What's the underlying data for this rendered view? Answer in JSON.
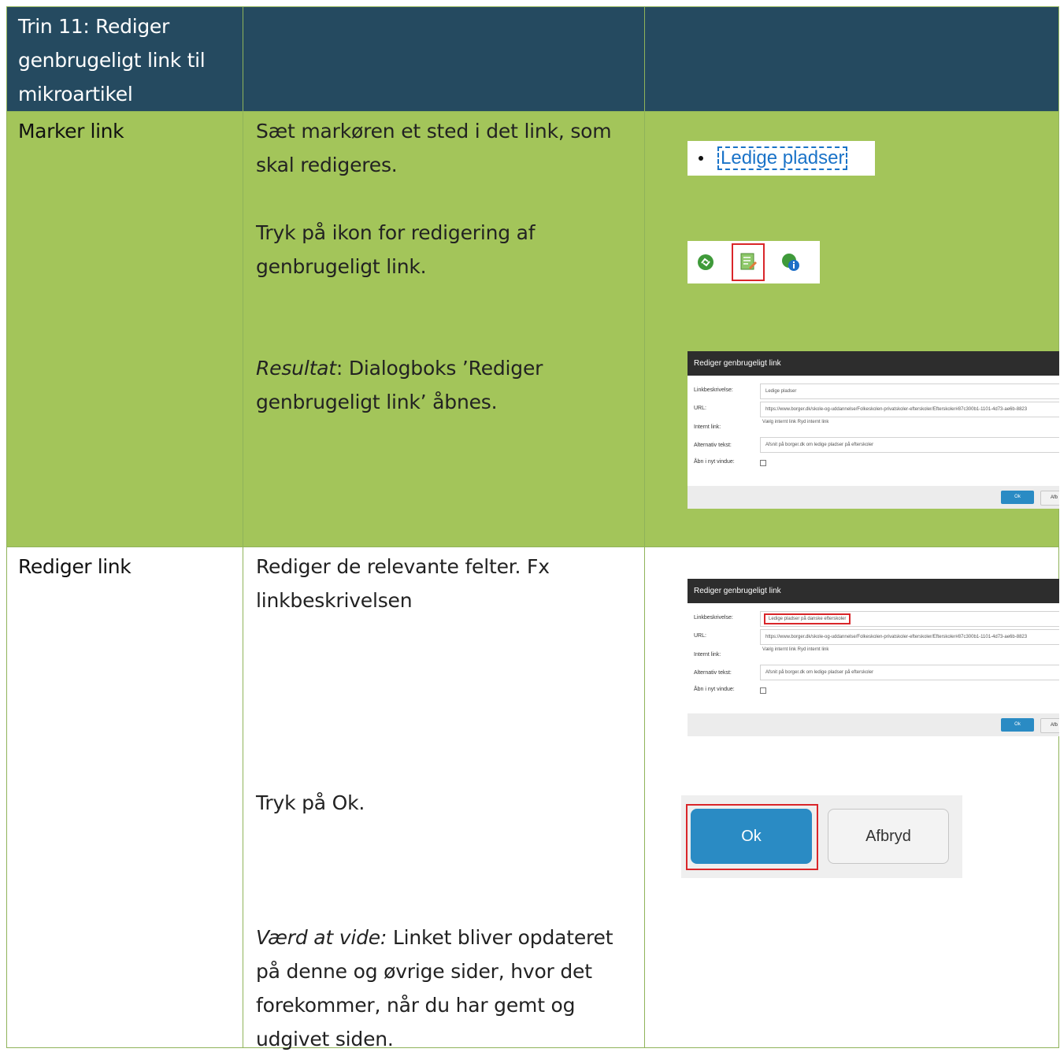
{
  "header": {
    "title": "Trin 11: Rediger genbrugeligt link til mikroartikel"
  },
  "row1": {
    "label": "Marker link",
    "instruction1": "Sæt markøren et sted i det link, som skal redigeres.",
    "instruction2": "Tryk på ikon for redigering af genbrugeligt link.",
    "result_prefix": "Resultat",
    "result_text": ": Dialogboks ’Rediger genbrugeligt link’ åbnes.",
    "link_text": "Ledige pladser",
    "icons": [
      "recycle-link-icon",
      "edit-reusable-link-icon",
      "reusable-link-info-icon"
    ]
  },
  "dialog1": {
    "title": "Rediger genbrugeligt link",
    "labels": {
      "description": "Linkbeskrivelse:",
      "url": "URL:",
      "internal": "Internt link:",
      "alt": "Alternativ tekst:",
      "new_window": "Åbn i nyt vindue:"
    },
    "description_value": "Ledige pladser",
    "url_value": "https://www.borger.dk/skole-og-uddannelse/Folkeskolen-privatskoler-efterskoler/Efterskoler#87c300b1-1101-4d73-ae6b-8823",
    "internal_links": "Vælg internt link  Ryd internt link",
    "alt_value": "Afsnit på borger.dk om ledige pladser på efterskoler",
    "ok": "Ok",
    "cancel": "Afb"
  },
  "row2": {
    "label": "Rediger link",
    "instruction1": "Rediger de relevante felter. Fx linkbeskrivelsen",
    "instruction2": "Tryk på Ok.",
    "note_prefix": "Værd at vide:",
    "note_text": " Linket bliver opdateret på denne og øvrige sider, hvor det forekommer, når du har gemt og udgivet siden."
  },
  "dialog2": {
    "title": "Rediger genbrugeligt link",
    "labels": {
      "description": "Linkbeskrivelse:",
      "url": "URL:",
      "internal": "Internt link:",
      "alt": "Alternativ tekst:",
      "new_window": "Åbn i nyt vindue:"
    },
    "description_value": "Ledige pladser på danske efterskoler",
    "url_value": "https://www.borger.dk/skole-og-uddannelse/Folkeskolen-privatskoler-efterskoler/Efterskoler#87c300b1-1101-4d73-ae6b-8823",
    "internal_links": "Vælg internt link  Ryd internt link",
    "alt_value": "Afsnit på borger.dk om ledige pladser på efterskoler",
    "ok": "Ok",
    "cancel": "Afb"
  },
  "buttons": {
    "ok": "Ok",
    "cancel": "Afbryd"
  },
  "colors": {
    "header_bg": "#254a60",
    "green_bg": "#a3c55a",
    "border": "#8fb35a",
    "highlight": "#d9262a",
    "ok_blue": "#2a8bc4"
  }
}
